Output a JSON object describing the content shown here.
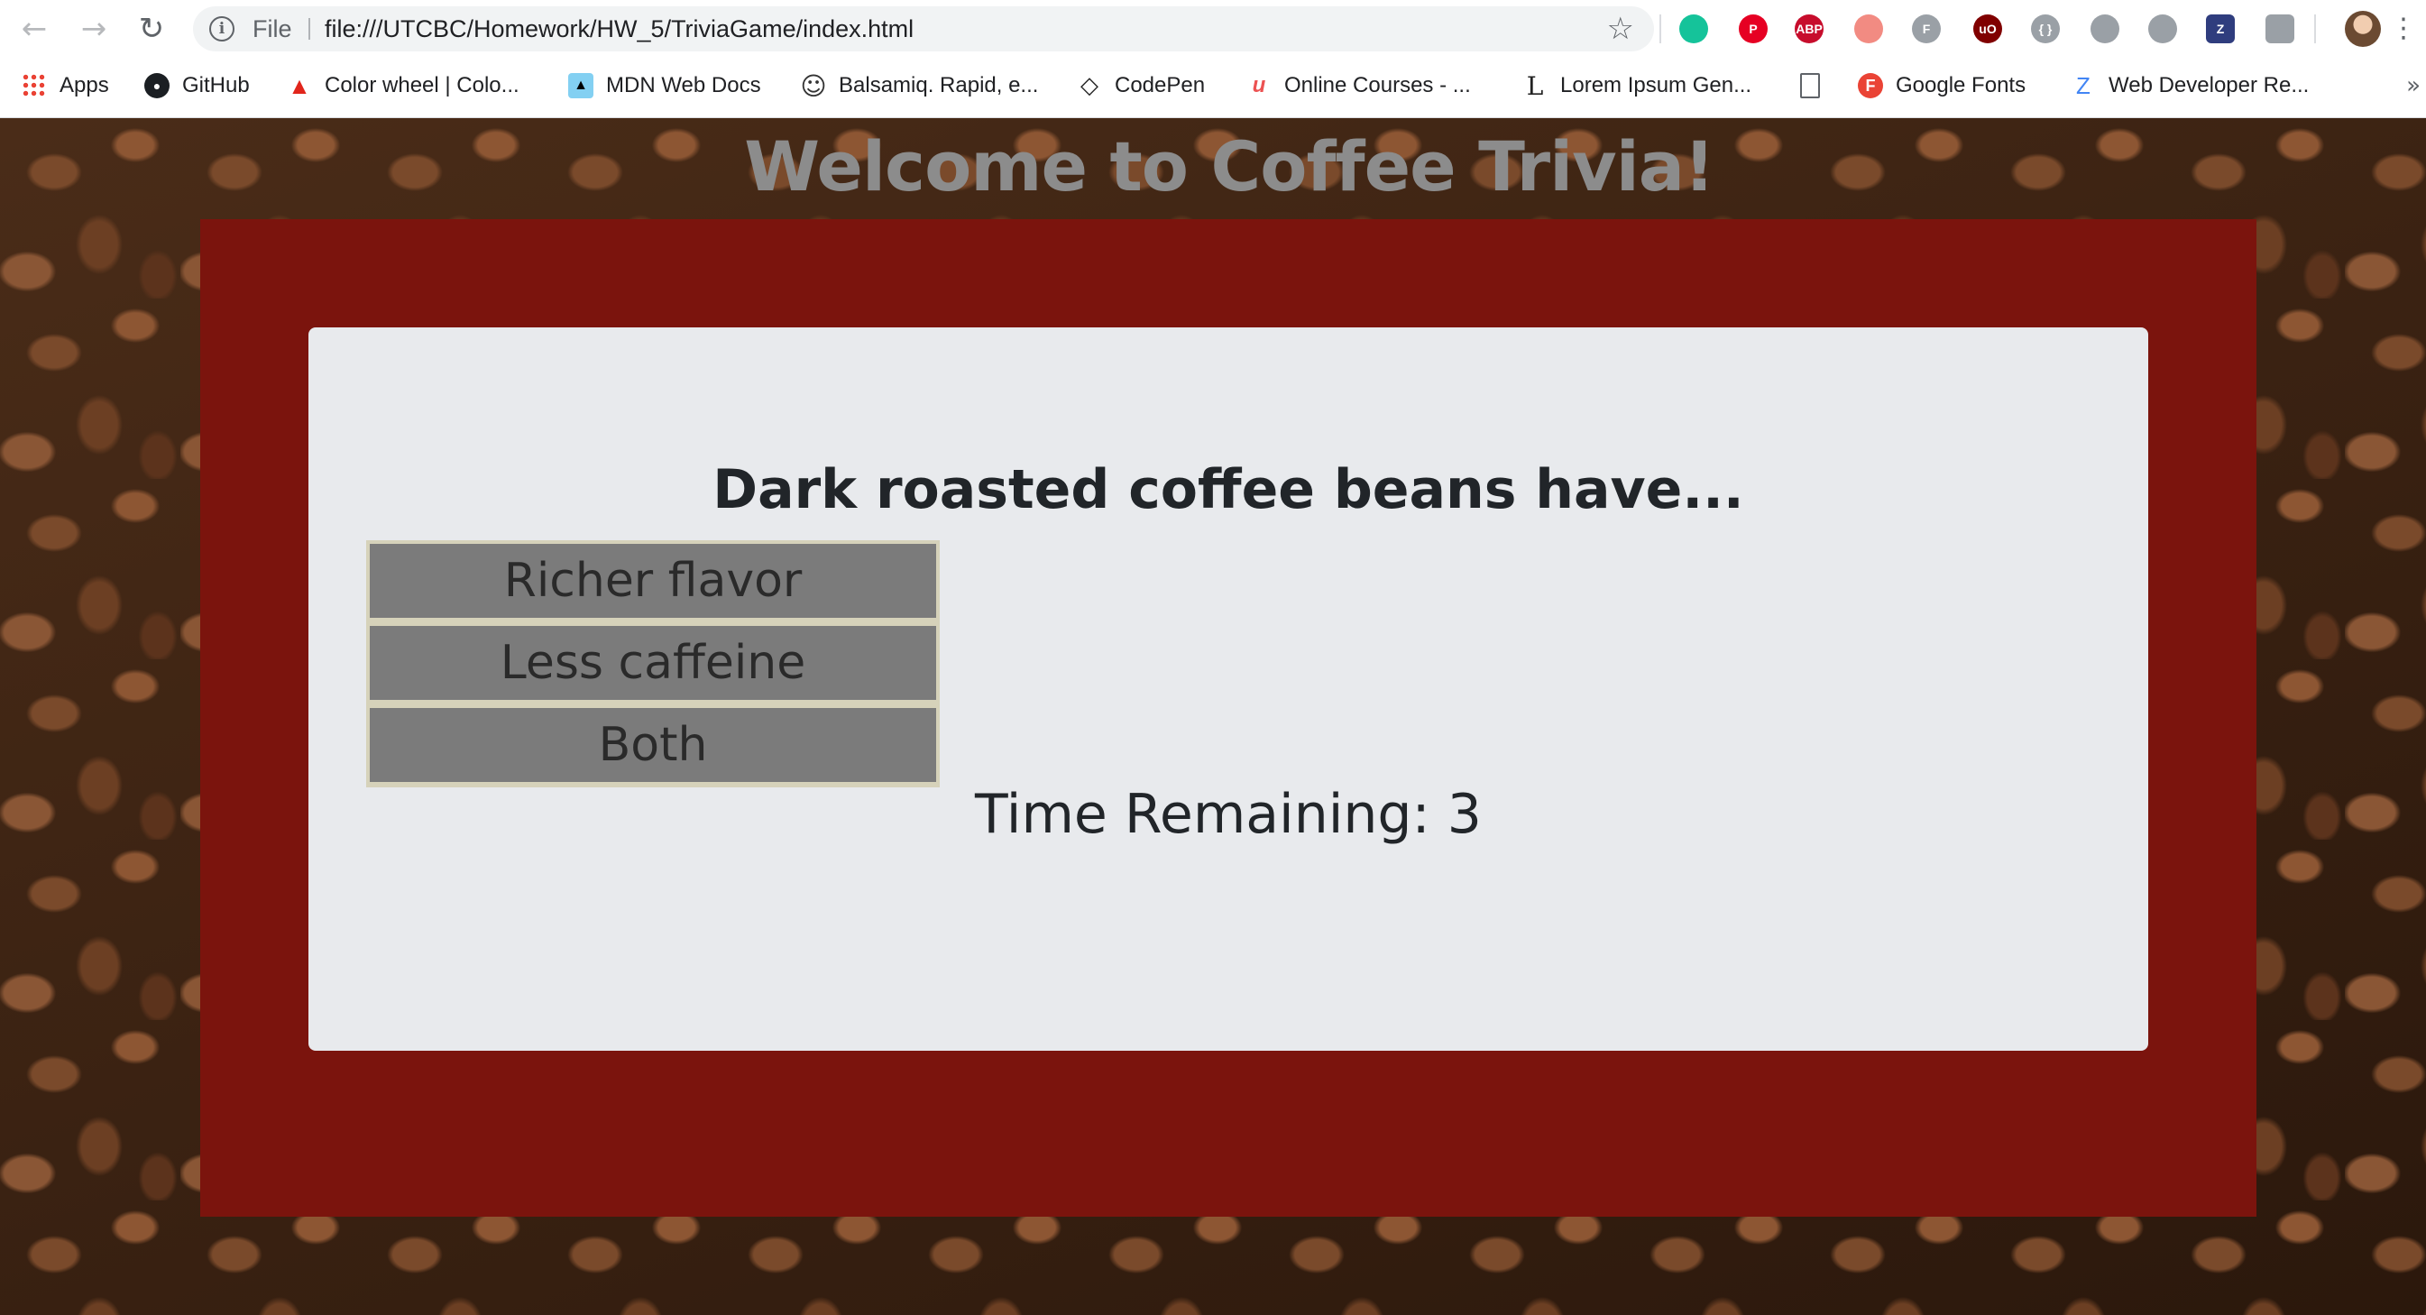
{
  "browser": {
    "url_scheme_label": "File",
    "url": "file:///UTCBC/Homework/HW_5/TriviaGame/index.html",
    "nav_icons": [
      "back-arrow-icon",
      "forward-arrow-icon",
      "reload-icon"
    ],
    "extensions": [
      {
        "name": "grammarly-icon",
        "label": "",
        "color": "#15c39a"
      },
      {
        "name": "pinterest-icon",
        "label": "P",
        "color": "#e60023"
      },
      {
        "name": "adblock-plus-icon",
        "label": "ABP",
        "color": "#c70d2c"
      },
      {
        "name": "video-extension-icon",
        "label": "",
        "color": "#f28b82"
      },
      {
        "name": "whatfont-icon",
        "label": "F",
        "color": "#9aa0a6"
      },
      {
        "name": "ublock-origin-icon",
        "label": "uO",
        "color": "#800000"
      },
      {
        "name": "json-viewer-icon",
        "label": "{ }",
        "color": "#9aa0a6"
      },
      {
        "name": "react-devtools-icon",
        "label": "",
        "color": "#9aa0a6"
      },
      {
        "name": "loading-extension-icon",
        "label": "",
        "color": "#9aa0a6"
      },
      {
        "name": "zotero-icon",
        "label": "Z",
        "color": "#2f3d7e"
      },
      {
        "name": "puzzle-extension-icon",
        "label": "",
        "color": "#9aa0a6"
      }
    ]
  },
  "bookmarks": [
    {
      "label": "Apps",
      "icon": "apps-grid-icon"
    },
    {
      "label": "GitHub",
      "icon": "github-icon"
    },
    {
      "label": "Color wheel | Colo...",
      "icon": "adobe-icon"
    },
    {
      "label": "MDN Web Docs",
      "icon": "mdn-icon"
    },
    {
      "label": "Balsamiq. Rapid, e...",
      "icon": "smiley-icon"
    },
    {
      "label": "CodePen",
      "icon": "codepen-icon"
    },
    {
      "label": "Online Courses - ...",
      "icon": "udemy-icon"
    },
    {
      "label": "Lorem Ipsum Gen...",
      "icon": "lorem-ipsum-icon"
    },
    {
      "label": "",
      "icon": "blank-page-icon"
    },
    {
      "label": "Google Fonts",
      "icon": "google-fonts-icon"
    },
    {
      "label": "Web Developer Re...",
      "icon": "webdev-icon"
    }
  ],
  "page": {
    "title": "Welcome to Coffee Trivia!",
    "question": "Dark roasted coffee beans have...",
    "answers": [
      "Richer flavor",
      "Less caffeine",
      "Both"
    ],
    "timer_label": "Time Remaining:",
    "timer_value": "3",
    "timer_text": "Time Remaining: 3"
  },
  "colors": {
    "panel": "#7b140d",
    "card": "#e8eaed",
    "answer_button": "#7b7b7b",
    "answer_border": "#d6d2ba",
    "title": "#8c8c8c"
  }
}
